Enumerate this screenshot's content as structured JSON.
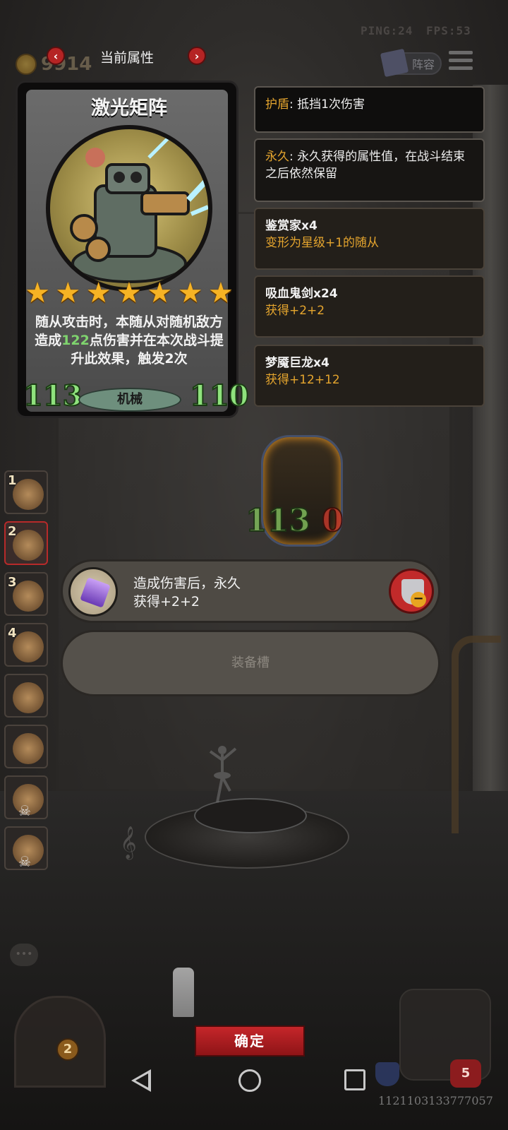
{
  "hud": {
    "ping": "PING:24",
    "fps": "FPS:53",
    "gold": "9914"
  },
  "header": {
    "title": "当前属性",
    "prev": "‹",
    "next": "›",
    "lineup": "阵容"
  },
  "card": {
    "name": "激光矩阵",
    "stars": 7,
    "description_parts": [
      "随从攻击时，本随从对随机敌方造成",
      "122",
      "点伤害并在本次战斗提升此效果，触发2次"
    ],
    "attack": "113",
    "health": "110",
    "tribe": "机械"
  },
  "keywords": [
    {
      "key": "护盾",
      "text": ": 抵挡1次伤害"
    },
    {
      "key": "永久",
      "text": ": 永久获得的属性值，在战斗结束之后依然保留"
    }
  ],
  "buffs": [
    {
      "name": "鉴赏家x4",
      "effect": "变形为星级+1的随从"
    },
    {
      "name": "吸血鬼剑x24",
      "effect": "获得+2+2"
    },
    {
      "name": "梦魇巨龙x4",
      "effect": "获得+12+12"
    }
  ],
  "board_minion": {
    "attack": "113",
    "health": "0"
  },
  "roster": [
    "1",
    "2",
    "3",
    "4",
    "",
    "",
    "",
    ""
  ],
  "equipment": {
    "line1": "造成伤害后，永久",
    "line2": "获得+2+2",
    "empty_slot": "装备槽"
  },
  "bottom": {
    "confirm": "确定",
    "door_level": "2",
    "hearts": "5",
    "seed": "1121103133777057"
  },
  "colors": {
    "accent_red": "#c12a2a",
    "keyword": "#e5a52e",
    "stat_green": "#8fe27d"
  }
}
